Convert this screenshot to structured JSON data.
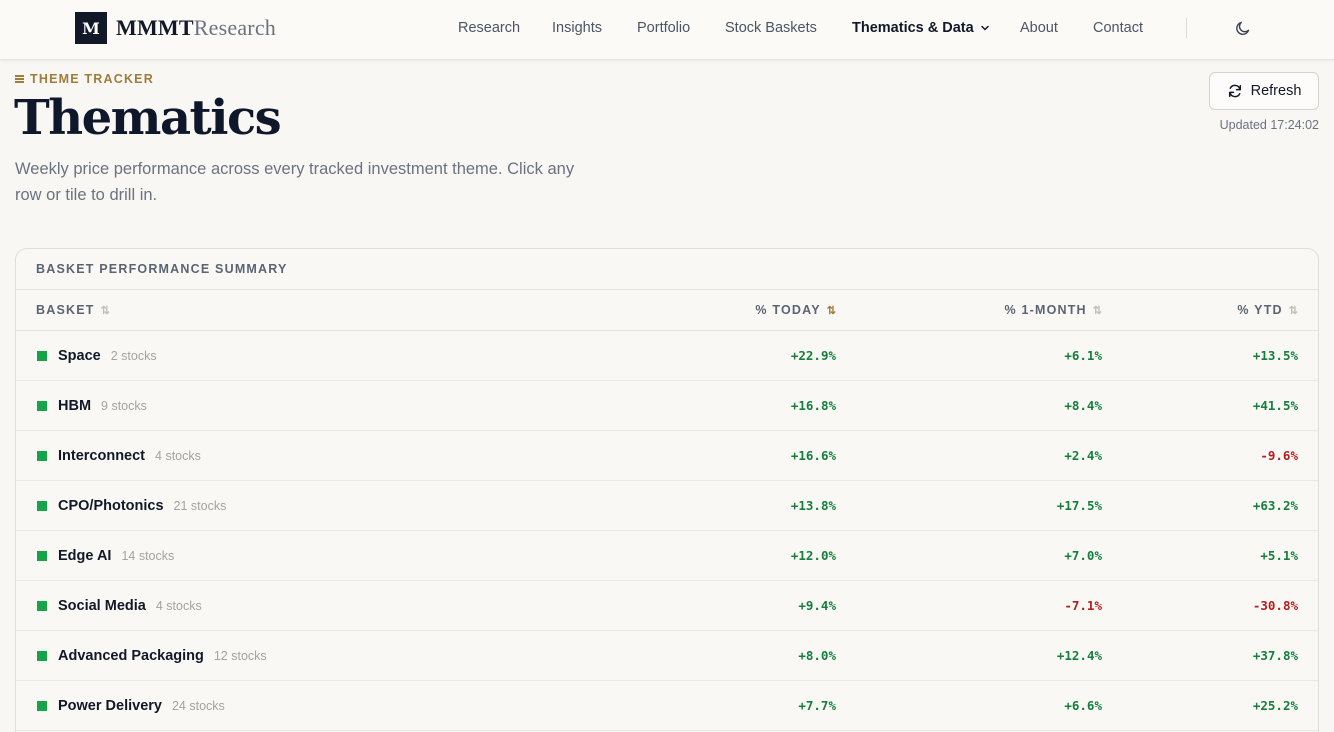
{
  "header": {
    "logo_mark": "M",
    "logo_bold": "MMMT",
    "logo_light": "Research",
    "nav": [
      {
        "label": "Research"
      },
      {
        "label": "Insights"
      },
      {
        "label": "Portfolio"
      },
      {
        "label": "Stock Baskets"
      },
      {
        "label": "Thematics & Data",
        "active": true
      },
      {
        "label": "About"
      },
      {
        "label": "Contact"
      }
    ]
  },
  "hero": {
    "eyebrow": "THEME TRACKER",
    "title": "Thematics",
    "subtitle": "Weekly price performance across every tracked investment theme. Click any row or tile to drill in.",
    "refresh_label": "Refresh",
    "updated": "Updated 17:24:02"
  },
  "table": {
    "title": "BASKET PERFORMANCE SUMMARY",
    "columns": {
      "basket": "BASKET",
      "today": "% TODAY",
      "month": "% 1-MONTH",
      "ytd": "% YTD"
    },
    "sorted_by": "today",
    "rows": [
      {
        "name": "Space",
        "count": "2 stocks",
        "today": "+22.9%",
        "month": "+6.1%",
        "ytd": "+13.5%"
      },
      {
        "name": "HBM",
        "count": "9 stocks",
        "today": "+16.8%",
        "month": "+8.4%",
        "ytd": "+41.5%"
      },
      {
        "name": "Interconnect",
        "count": "4 stocks",
        "today": "+16.6%",
        "month": "+2.4%",
        "ytd": "-9.6%"
      },
      {
        "name": "CPO/Photonics",
        "count": "21 stocks",
        "today": "+13.8%",
        "month": "+17.5%",
        "ytd": "+63.2%"
      },
      {
        "name": "Edge AI",
        "count": "14 stocks",
        "today": "+12.0%",
        "month": "+7.0%",
        "ytd": "+5.1%"
      },
      {
        "name": "Social Media",
        "count": "4 stocks",
        "today": "+9.4%",
        "month": "-7.1%",
        "ytd": "-30.8%"
      },
      {
        "name": "Advanced Packaging",
        "count": "12 stocks",
        "today": "+8.0%",
        "month": "+12.4%",
        "ytd": "+37.8%"
      },
      {
        "name": "Power Delivery",
        "count": "24 stocks",
        "today": "+7.7%",
        "month": "+6.6%",
        "ytd": "+25.2%"
      }
    ]
  },
  "colors": {
    "accent": "#a07c3c",
    "positive": "#15803d",
    "negative": "#b91c1c",
    "marker": "#16a34a"
  }
}
